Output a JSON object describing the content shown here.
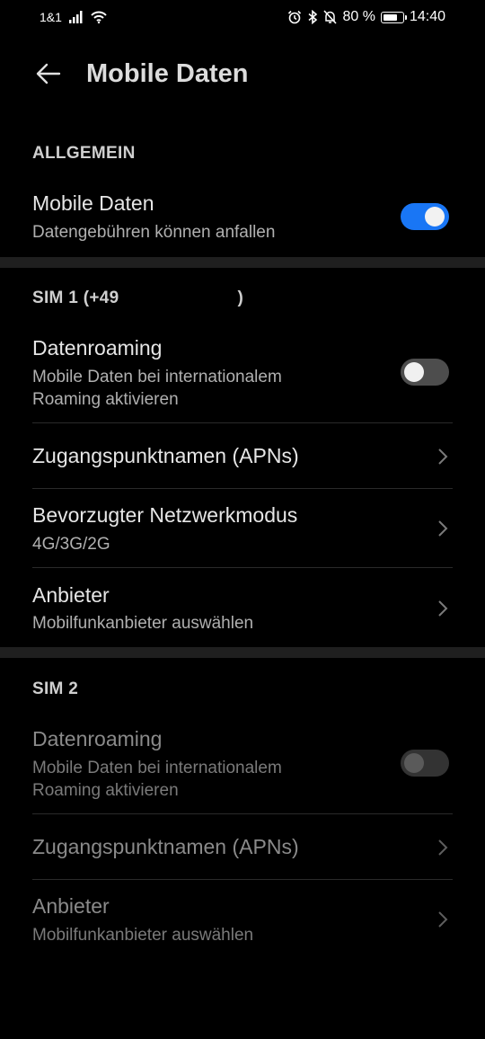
{
  "status_bar": {
    "carrier": "1&1",
    "battery": "80 %",
    "time": "14:40",
    "battery_level": 0.8
  },
  "header": {
    "title": "Mobile Daten"
  },
  "general": {
    "heading": "ALLGEMEIN",
    "mobile_data": {
      "title": "Mobile Daten",
      "subtitle": "Datengebühren können anfallen",
      "enabled": true
    }
  },
  "sim1": {
    "heading": "SIM 1 (+49",
    "heading_end": ")",
    "roaming": {
      "title": "Datenroaming",
      "subtitle_1": "Mobile Daten bei internationalem",
      "subtitle_2": "Roaming aktivieren",
      "enabled": false
    },
    "apn": {
      "title": "Zugangspunktnamen (APNs)"
    },
    "network_mode": {
      "title": "Bevorzugter Netzwerkmodus",
      "value": "4G/3G/2G"
    },
    "provider": {
      "title": "Anbieter",
      "subtitle": "Mobilfunkanbieter auswählen"
    }
  },
  "sim2": {
    "heading": "SIM 2",
    "roaming": {
      "title": "Datenroaming",
      "subtitle_1": "Mobile Daten bei internationalem",
      "subtitle_2": "Roaming aktivieren",
      "enabled": false
    },
    "apn": {
      "title": "Zugangspunktnamen (APNs)"
    },
    "provider": {
      "title": "Anbieter",
      "subtitle": "Mobilfunkanbieter auswählen"
    }
  },
  "colors": {
    "accent": "#1976f5",
    "background": "#000000"
  }
}
